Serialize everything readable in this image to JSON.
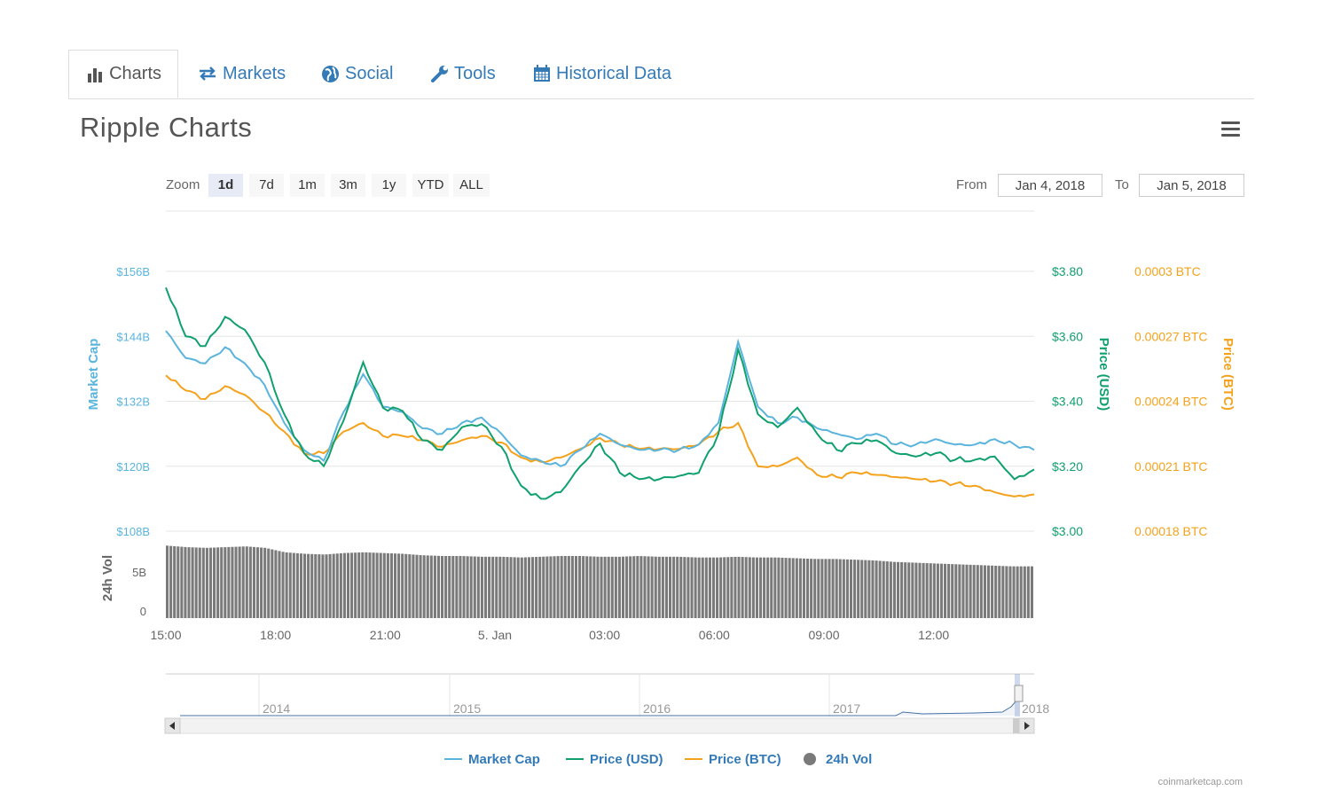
{
  "tabs": [
    {
      "label": "Charts",
      "icon": "bar-chart-icon",
      "active": true
    },
    {
      "label": "Markets",
      "icon": "exchange-arrows-icon",
      "active": false
    },
    {
      "label": "Social",
      "icon": "globe-icon",
      "active": false
    },
    {
      "label": "Tools",
      "icon": "wrench-icon",
      "active": false
    },
    {
      "label": "Historical Data",
      "icon": "calendar-icon",
      "active": false
    }
  ],
  "page_title": "Ripple Charts",
  "menu_icon": "hamburger-menu-icon",
  "zoom": {
    "label": "Zoom",
    "options": [
      "1d",
      "7d",
      "1m",
      "3m",
      "1y",
      "YTD",
      "ALL"
    ],
    "selected": "1d"
  },
  "range": {
    "from_label": "From",
    "from_value": "Jan 4, 2018",
    "to_label": "To",
    "to_value": "Jan 5, 2018"
  },
  "colors": {
    "market_cap": "#5ab4dc",
    "price_usd": "#10a06e",
    "price_btc": "#f4a21b",
    "volume": "#7a7a7a",
    "link": "#337ab7"
  },
  "chart_data": {
    "type": "line",
    "x_ticks": [
      "15:00",
      "18:00",
      "21:00",
      "5. Jan",
      "03:00",
      "06:00",
      "09:00",
      "12:00"
    ],
    "left_axis": {
      "label": "Market Cap",
      "ticks": [
        "$156B",
        "$144B",
        "$132B",
        "$120B",
        "$108B"
      ],
      "range": [
        108,
        156
      ]
    },
    "right_axis_usd": {
      "label": "Price (USD)",
      "ticks": [
        "$3.80",
        "$3.60",
        "$3.40",
        "$3.20",
        "$3.00"
      ],
      "range": [
        3.0,
        3.8
      ]
    },
    "right_axis_btc": {
      "label": "Price (BTC)",
      "ticks": [
        "0.0003 BTC",
        "0.00027 BTC",
        "0.00024 BTC",
        "0.00021 BTC",
        "0.00018 BTC"
      ],
      "range": [
        0.00018,
        0.0003
      ]
    },
    "volume_axis": {
      "label": "24h Vol",
      "ticks": [
        "5B",
        "0"
      ],
      "range": [
        0,
        10.2
      ]
    },
    "hours": [
      0,
      0.5,
      1,
      1.5,
      2,
      2.5,
      3,
      3.5,
      4,
      4.5,
      5,
      5.5,
      6,
      6.5,
      7,
      7.5,
      8,
      8.5,
      9,
      9.5,
      10,
      10.5,
      11,
      11.5,
      12,
      12.5,
      13,
      13.5,
      14,
      14.5,
      15,
      15.5,
      16,
      16.5,
      17,
      17.5,
      18,
      18.5,
      19,
      19.5,
      20,
      20.5,
      21,
      21.5,
      22,
      22.5,
      23,
      23.5,
      24
    ],
    "series": [
      {
        "name": "Market Cap",
        "axis": "left",
        "values": [
          145,
          140,
          139,
          142,
          139,
          135,
          128,
          123,
          121,
          130,
          137,
          131,
          130,
          127,
          126,
          128,
          129,
          126,
          122,
          121,
          120,
          123,
          126,
          124,
          123,
          123,
          123,
          124,
          128,
          143,
          131,
          128,
          129,
          127,
          126,
          125,
          126,
          124,
          124,
          125,
          124,
          124,
          125,
          124,
          123
        ]
      },
      {
        "name": "Price (USD)",
        "axis": "usd",
        "values": [
          3.75,
          3.6,
          3.57,
          3.66,
          3.62,
          3.52,
          3.36,
          3.24,
          3.2,
          3.34,
          3.52,
          3.38,
          3.37,
          3.28,
          3.25,
          3.32,
          3.33,
          3.26,
          3.14,
          3.1,
          3.12,
          3.2,
          3.27,
          3.18,
          3.16,
          3.16,
          3.17,
          3.18,
          3.3,
          3.56,
          3.36,
          3.32,
          3.38,
          3.3,
          3.25,
          3.27,
          3.28,
          3.24,
          3.23,
          3.24,
          3.22,
          3.22,
          3.23,
          3.16,
          3.19
        ]
      },
      {
        "name": "Price (BTC)",
        "axis": "btc",
        "values": [
          0.000252,
          0.000245,
          0.000241,
          0.000247,
          0.000243,
          0.000235,
          0.000226,
          0.000216,
          0.000216,
          0.000226,
          0.00023,
          0.000224,
          0.000224,
          0.000222,
          0.000219,
          0.000222,
          0.000224,
          0.000221,
          0.000214,
          0.000212,
          0.000214,
          0.000218,
          0.000223,
          0.00022,
          0.000218,
          0.000218,
          0.000218,
          0.00022,
          0.000226,
          0.00023,
          0.00021,
          0.00021,
          0.000214,
          0.000206,
          0.000205,
          0.000207,
          0.000206,
          0.000205,
          0.000204,
          0.000203,
          0.000202,
          0.000201,
          0.000198,
          0.000196,
          0.000197
        ]
      },
      {
        "name": "24h Vol",
        "axis": "volume",
        "values": [
          9.8,
          9.6,
          9.5,
          9.6,
          9.7,
          9.5,
          8.9,
          8.7,
          8.6,
          8.8,
          8.9,
          8.8,
          8.7,
          8.5,
          8.4,
          8.4,
          8.3,
          8.3,
          8.2,
          8.3,
          8.4,
          8.4,
          8.3,
          8.3,
          8.4,
          8.3,
          8.3,
          8.2,
          8.2,
          8.3,
          8.2,
          8.2,
          8.1,
          8.0,
          8.0,
          7.9,
          7.8,
          7.6,
          7.5,
          7.4,
          7.3,
          7.2,
          7.1,
          7.0,
          7.0
        ]
      }
    ],
    "navigator": {
      "years": [
        "2014",
        "2015",
        "2016",
        "2017",
        "2018"
      ]
    },
    "legend": [
      {
        "name": "Market Cap",
        "marker": "line"
      },
      {
        "name": "Price (USD)",
        "marker": "line"
      },
      {
        "name": "Price (BTC)",
        "marker": "line"
      },
      {
        "name": "24h Vol",
        "marker": "circle"
      }
    ],
    "legend_position": "bottom",
    "grid": true
  },
  "credit": "coinmarketcap.com"
}
